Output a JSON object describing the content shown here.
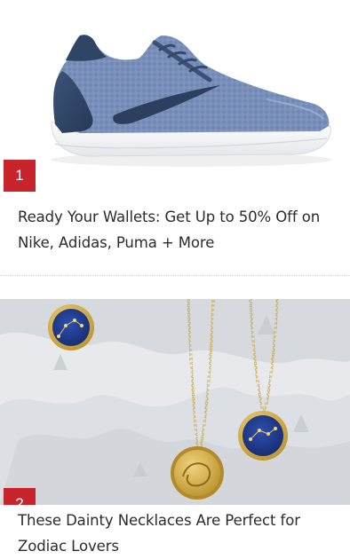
{
  "feed": {
    "items": [
      {
        "rank": "1",
        "title": "Ready Your Wallets: Get Up to 50% Off on Nike, Adidas, Puma + More",
        "image_icon": "sneaker-image",
        "colors": {
          "shoe_upper": "#6e85b0",
          "shoe_heel": "#2f4566",
          "sole": "#ffffff"
        }
      },
      {
        "rank": "2",
        "title": "These Dainty Necklaces Are Perfect for Zodiac Lovers",
        "image_icon": "zodiac-necklaces-image",
        "colors": {
          "pendant_blue": "#1f3b8a",
          "gold": "#c9a440",
          "background": "#e6e8ea"
        }
      }
    ],
    "badge_color": "#c7242b"
  }
}
